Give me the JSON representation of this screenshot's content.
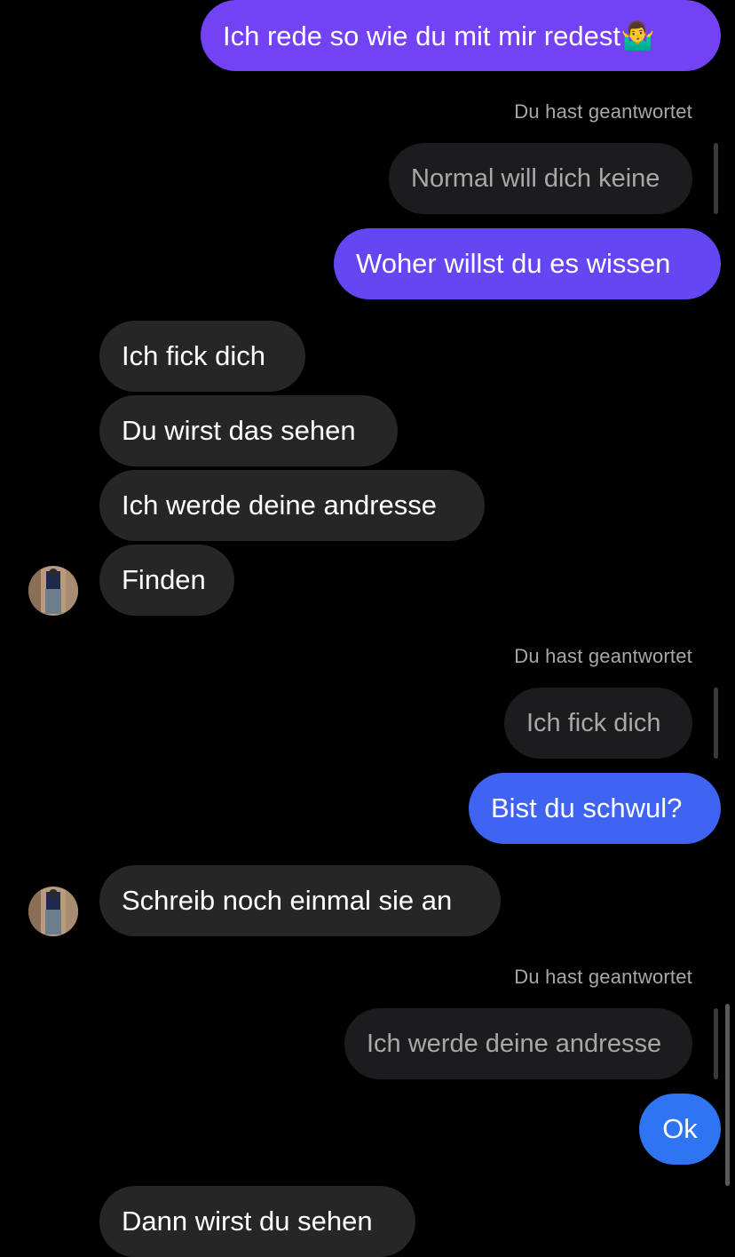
{
  "messages": {
    "m1": "Ich rede so wie du mit mir redest🤷‍♂️",
    "reply1_label": "Du hast geantwortet",
    "reply1_quote": "Normal will dich keine",
    "m2": "Woher willst du es wissen",
    "m3": "Ich fick dich",
    "m4": "Du wirst das sehen",
    "m5": "Ich werde deine andresse",
    "m6": "Finden",
    "reply2_label": "Du hast geantwortet",
    "reply2_quote": "Ich fick dich",
    "m7": "Bist du schwul?",
    "m8": "Schreib noch einmal sie an",
    "reply3_label": "Du hast geantwortet",
    "reply3_quote": "Ich werde deine andresse",
    "m9": "Ok",
    "m10": "Dann wirst du sehen"
  },
  "colors": {
    "outgoing_purple": "#7342f5",
    "outgoing_violet": "#6446f3",
    "outgoing_blue_violet": "#3f63f2",
    "outgoing_blue": "#2e74f3",
    "incoming": "#262626",
    "background": "#000000"
  }
}
